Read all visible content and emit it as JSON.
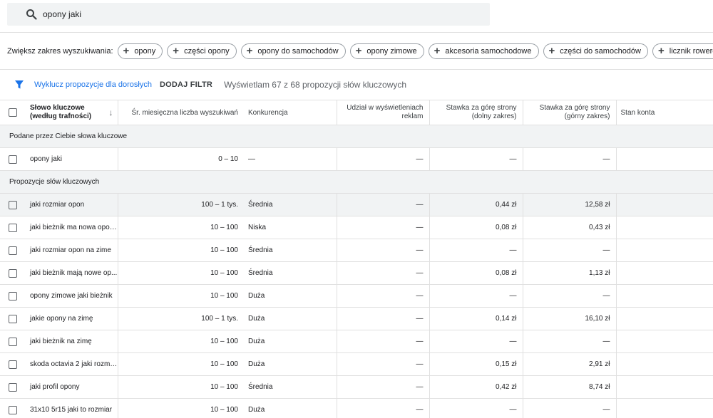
{
  "search": {
    "query": "opony jaki"
  },
  "refine": {
    "label": "Zwiększ zakres wyszukiwania:",
    "chips": [
      "opony",
      "części opony",
      "opony do samochodów",
      "opony zimowe",
      "akcesoria samochodowe",
      "części do samochodów",
      "licznik rowerowy jaki"
    ]
  },
  "filters": {
    "exclude_adult": "Wyklucz propozycje dla dorosłych",
    "add_filter": "DODAJ FILTR",
    "showing": "Wyświetlam 67 z 68 propozycji słów kluczowych"
  },
  "table": {
    "headers": {
      "keyword_line1": "Słowo kluczowe",
      "keyword_line2": "(według trafności)",
      "avg_searches": "Śr. miesięczna liczba wyszukiwań",
      "competition": "Konkurencja",
      "impr_share_line1": "Udział w wyświetleniach",
      "impr_share_line2": "reklam",
      "bid_low_line1": "Stawka za górę strony",
      "bid_low_line2": "(dolny zakres)",
      "bid_high_line1": "Stawka za górę strony",
      "bid_high_line2": "(górny zakres)",
      "account_status": "Stan konta"
    },
    "group_provided": "Podane przez Ciebie słowa kluczowe",
    "provided_rows": [
      {
        "keyword": "opony jaki",
        "searches": "0 – 10",
        "competition": "—",
        "share": "—",
        "bid_low": "—",
        "bid_high": "—",
        "status": ""
      }
    ],
    "group_ideas": "Propozycje słów kluczowych",
    "idea_rows": [
      {
        "keyword": "jaki rozmiar opon",
        "searches": "100 – 1 tys.",
        "competition": "Średnia",
        "share": "—",
        "bid_low": "0,44 zł",
        "bid_high": "12,58 zł",
        "status": ""
      },
      {
        "keyword": "jaki bieżnik ma nowa opona",
        "searches": "10 – 100",
        "competition": "Niska",
        "share": "—",
        "bid_low": "0,08 zł",
        "bid_high": "0,43 zł",
        "status": ""
      },
      {
        "keyword": "jaki rozmiar opon na zime",
        "searches": "10 – 100",
        "competition": "Średnia",
        "share": "—",
        "bid_low": "—",
        "bid_high": "—",
        "status": ""
      },
      {
        "keyword": "jaki bieżnik mają nowe op...",
        "searches": "10 – 100",
        "competition": "Średnia",
        "share": "—",
        "bid_low": "0,08 zł",
        "bid_high": "1,13 zł",
        "status": ""
      },
      {
        "keyword": "opony zimowe jaki bieżnik",
        "searches": "10 – 100",
        "competition": "Duża",
        "share": "—",
        "bid_low": "—",
        "bid_high": "—",
        "status": ""
      },
      {
        "keyword": "jakie opony na zimę",
        "searches": "100 – 1 tys.",
        "competition": "Duża",
        "share": "—",
        "bid_low": "0,14 zł",
        "bid_high": "16,10 zł",
        "status": ""
      },
      {
        "keyword": "jaki bieżnik na zimę",
        "searches": "10 – 100",
        "competition": "Duża",
        "share": "—",
        "bid_low": "—",
        "bid_high": "—",
        "status": ""
      },
      {
        "keyword": "skoda octavia 2 jaki rozmi...",
        "searches": "10 – 100",
        "competition": "Duża",
        "share": "—",
        "bid_low": "0,15 zł",
        "bid_high": "2,91 zł",
        "status": ""
      },
      {
        "keyword": "jaki profil opony",
        "searches": "10 – 100",
        "competition": "Średnia",
        "share": "—",
        "bid_low": "0,42 zł",
        "bid_high": "8,74 zł",
        "status": ""
      },
      {
        "keyword": "31x10 5r15 jaki to rozmiar",
        "searches": "10 – 100",
        "competition": "Duża",
        "share": "—",
        "bid_low": "—",
        "bid_high": "—",
        "status": ""
      }
    ]
  },
  "colors": {
    "link": "#1a73e8",
    "row_highlight": "#f1f3f4",
    "search_bg": "#f1f3f4"
  },
  "icons": {
    "search": "search-icon",
    "filter": "filter-icon",
    "chip": "plus-icon",
    "sort": "arrow-down-icon"
  }
}
